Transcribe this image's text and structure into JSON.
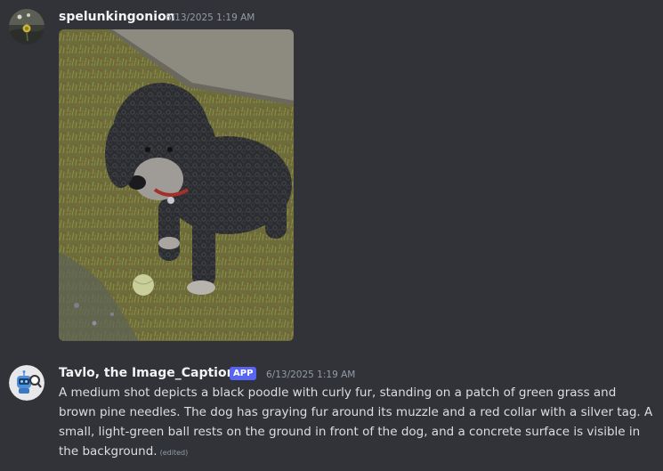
{
  "messages": [
    {
      "username": "spelunkingonion",
      "timestamp": "6/13/2025 1:19 AM",
      "attachment": {
        "type": "image",
        "description": "photo of a black curly-haired poodle on grass with a concrete surface"
      }
    },
    {
      "username": "Tavlo, the Image_Captioner",
      "badge": "APP",
      "timestamp": "6/13/2025 1:19 AM",
      "text": "A medium shot depicts a black poodle with curly fur, standing on a patch of green grass and brown pine needles. The dog has graying fur around its muzzle and a red collar with a silver tag. A small, light-green ball rests on the ground in front of the dog, and a concrete surface is visible in the background.",
      "edited_label": "(edited)"
    }
  ],
  "colors": {
    "background": "#313338",
    "username": "#f2f3f5",
    "text": "#dbdee1",
    "muted": "#949ba4",
    "app_badge": "#5865f2"
  },
  "icons": {
    "avatar_1": "user-avatar-flower",
    "avatar_2": "bot-avatar-robot-magnifier"
  }
}
